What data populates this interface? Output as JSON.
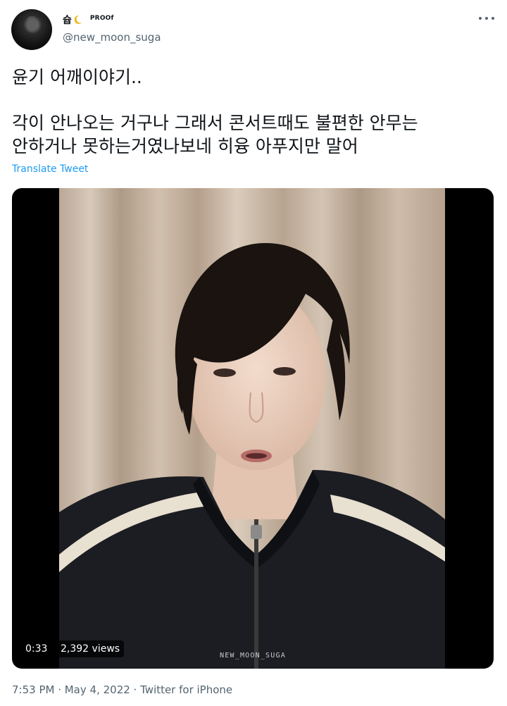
{
  "author": {
    "display_name": "슙",
    "badge": "PROOf",
    "handle": "@new_moon_suga"
  },
  "tweet": {
    "line1": "윤기 어깨이야기..",
    "line2": "각이 안나오는 거구나 그래서 콘서트때도 불편한 안무는",
    "line3": "안하거나 못하는거였나보네 히융 아푸지만 말어",
    "translate_label": "Translate Tweet"
  },
  "video": {
    "duration": "0:33",
    "views": "2,392 views",
    "watermark": "NEW_MOON_SUGA"
  },
  "meta": {
    "info": "7:53 PM · May 4, 2022 · Twitter for iPhone"
  },
  "icons": {
    "more": "more-horizontal-icon",
    "moon": "crescent-moon-icon"
  },
  "colors": {
    "link": "#1d9bf0",
    "secondary_text": "#536471"
  }
}
